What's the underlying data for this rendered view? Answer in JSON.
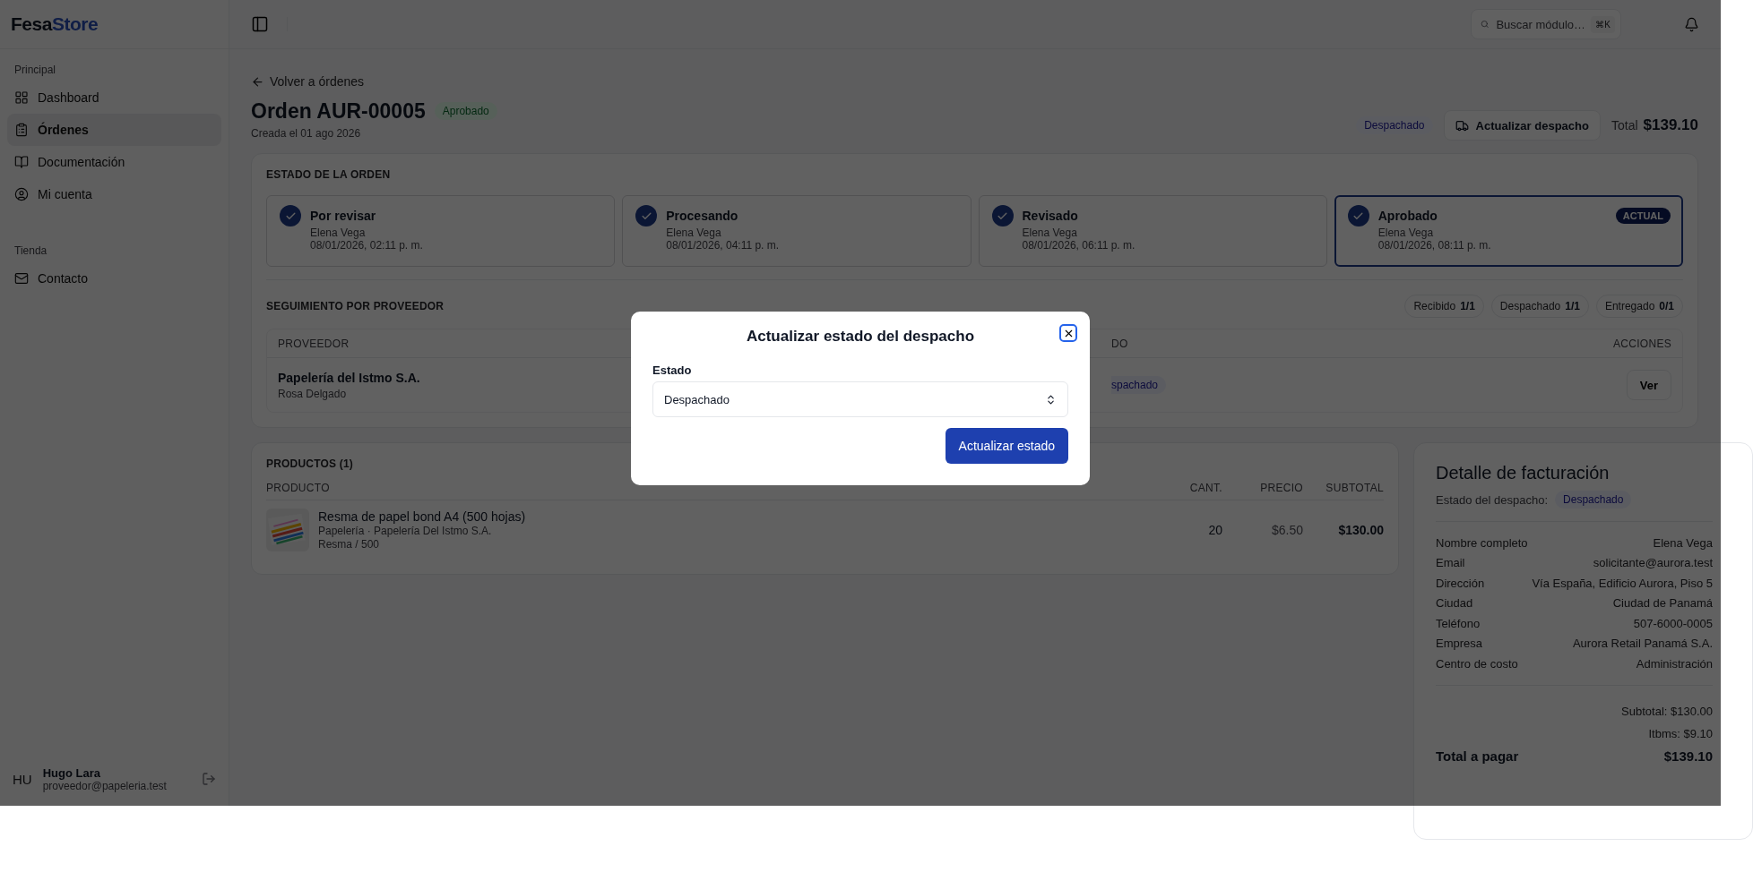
{
  "logo": [
    "Fesa",
    "Store"
  ],
  "sidebar": {
    "sections": [
      {
        "title": "Principal",
        "items": [
          {
            "label": "Dashboard",
            "selected": false
          },
          {
            "label": "Órdenes",
            "selected": true
          },
          {
            "label": "Documentación",
            "selected": false
          },
          {
            "label": "Mi cuenta",
            "selected": false
          }
        ]
      },
      {
        "title": "Tienda",
        "items": [
          {
            "label": "Contacto",
            "selected": false
          }
        ]
      }
    ],
    "user": {
      "initials": "HU",
      "name": "Hugo Lara",
      "email": "proveedor@papeleria.test"
    }
  },
  "header": {
    "search": {
      "placeholder": "Buscar módulo…",
      "shortcut": "⌘K"
    }
  },
  "order": {
    "back": "Volver a órdenes",
    "title": "Orden AUR-00005",
    "status": "Aprobado",
    "created": "Creada el 01 ago 2026",
    "dispatch_status": "Despachado",
    "update_button": "Actualizar despacho",
    "total_label": "Total",
    "total": "$139.10"
  },
  "status_section": {
    "title": "ESTADO DE LA ORDEN",
    "current_badge": "ACTUAL",
    "steps": [
      {
        "label": "Por revisar",
        "user": "Elena Vega",
        "date": "08/01/2026, 02:11 p. m.",
        "completed": true,
        "current": false
      },
      {
        "label": "Procesando",
        "user": "Elena Vega",
        "date": "08/01/2026, 04:11 p. m.",
        "completed": true,
        "current": false
      },
      {
        "label": "Revisado",
        "user": "Elena Vega",
        "date": "08/01/2026, 06:11 p. m.",
        "completed": true,
        "current": false
      },
      {
        "label": "Aprobado",
        "user": "Elena Vega",
        "date": "08/01/2026, 08:11 p. m.",
        "completed": true,
        "current": true
      }
    ]
  },
  "tracking": {
    "title": "SEGUIMIENTO POR PROVEEDOR",
    "chips": [
      {
        "label": "Recibido",
        "count": "1/1"
      },
      {
        "label": "Despachado",
        "count": "1/1"
      },
      {
        "label": "Entregado",
        "count": "0/1"
      }
    ],
    "columns": [
      "PROVEEDOR",
      "DO",
      "ACCIONES"
    ],
    "rows": [
      {
        "provider": "Papelería del Istmo S.A.",
        "contact": "Rosa Delgado",
        "status": "spachado",
        "action": "Ver"
      }
    ]
  },
  "products": {
    "title": "PRODUCTOS (1)",
    "columns": [
      "PRODUCTO",
      "CANT.",
      "PRECIO",
      "SUBTOTAL"
    ],
    "rows": [
      {
        "name": "Resma de papel bond A4 (500 hojas)",
        "category": "Papelería · Papelería Del Istmo S.A.",
        "unit": "Resma / 500",
        "qty": "20",
        "price": "$6.50",
        "subtotal": "$130.00"
      }
    ]
  },
  "billing": {
    "title": "Detalle de facturación",
    "status_label": "Estado del despacho:",
    "status": "Despachado",
    "fields": [
      {
        "label": "Nombre completo",
        "value": "Elena Vega"
      },
      {
        "label": "Email",
        "value": "solicitante@aurora.test"
      },
      {
        "label": "Dirección",
        "value": "Vía España, Edificio Aurora, Piso 5"
      },
      {
        "label": "Ciudad",
        "value": "Ciudad de Panamá"
      },
      {
        "label": "Teléfono",
        "value": "507-6000-0005"
      },
      {
        "label": "Empresa",
        "value": "Aurora Retail Panamá S.A."
      },
      {
        "label": "Centro de costo",
        "value": "Administración"
      }
    ],
    "subtotal": "Subtotal: $130.00",
    "tax": "Itbms: $9.10",
    "total_label": "Total a pagar",
    "total": "$139.10"
  },
  "modal": {
    "title": "Actualizar estado del despacho",
    "field_label": "Estado",
    "value": "Despachado",
    "submit": "Actualizar estado"
  }
}
